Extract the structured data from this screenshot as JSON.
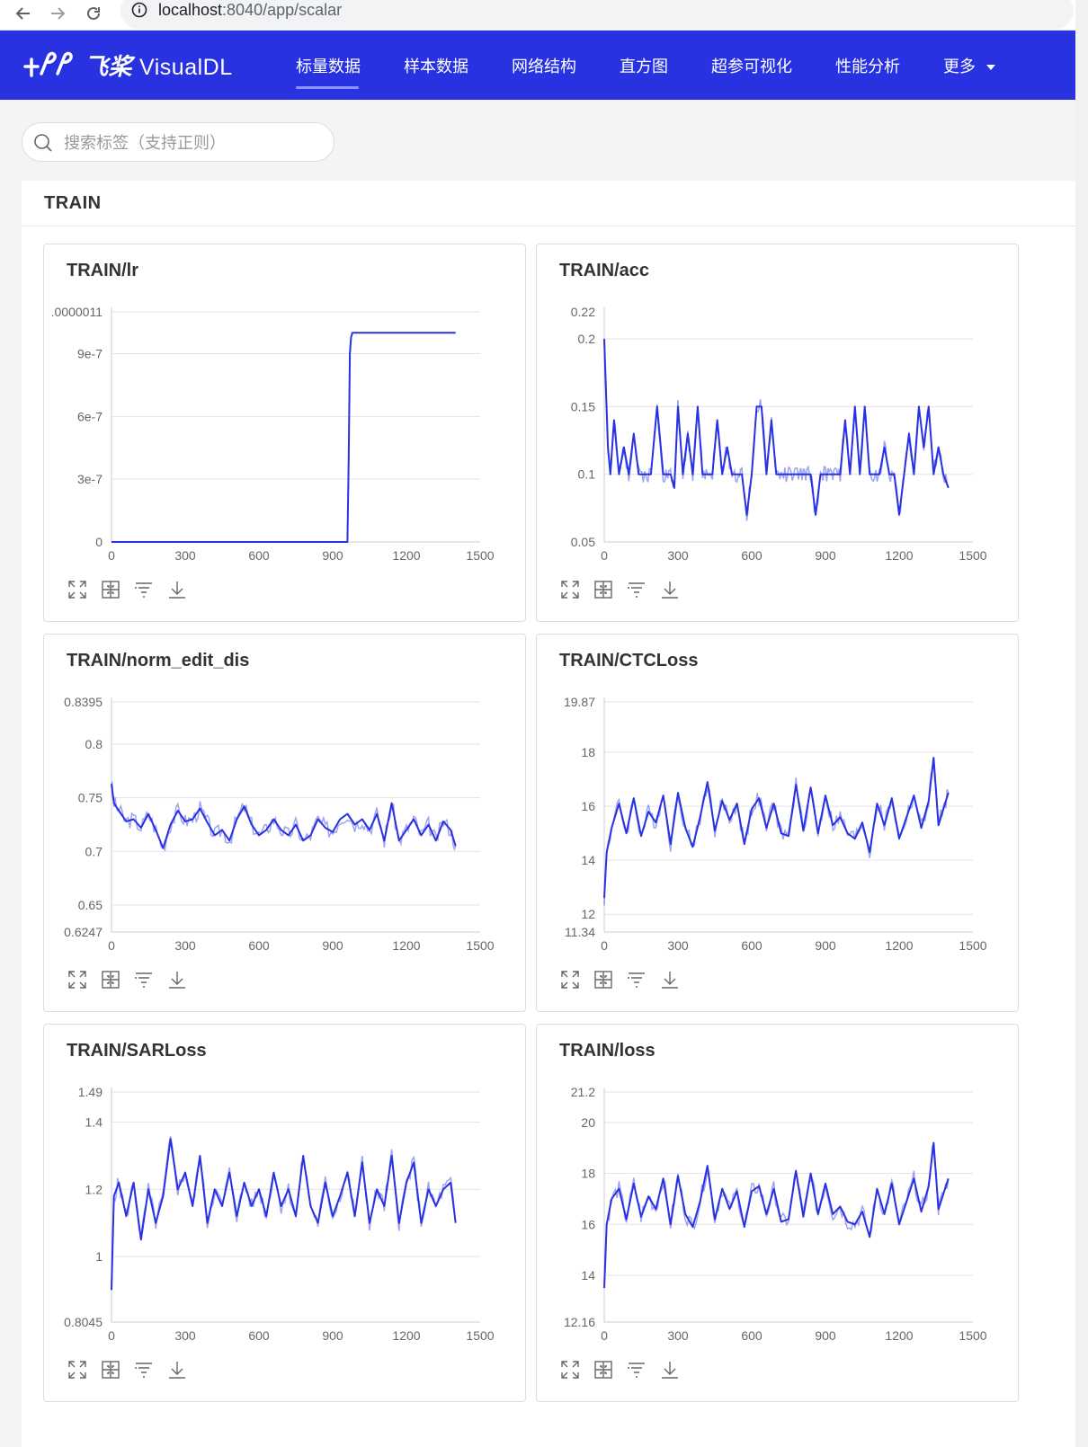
{
  "browser": {
    "url_host": "localhost",
    "url_rest": ":8040/app/scalar"
  },
  "app": {
    "logo_cn": "飞桨",
    "logo_en": "VisualDL",
    "nav": [
      {
        "label": "标量数据",
        "active": true
      },
      {
        "label": "样本数据",
        "active": false
      },
      {
        "label": "网络结构",
        "active": false
      },
      {
        "label": "直方图",
        "active": false
      },
      {
        "label": "超参可视化",
        "active": false
      },
      {
        "label": "性能分析",
        "active": false
      },
      {
        "label": "更多",
        "active": false
      }
    ],
    "colors": {
      "header_bg": "#2932e1",
      "series": "#2932e1"
    }
  },
  "search": {
    "placeholder": "搜索标签（支持正则）",
    "value": ""
  },
  "group": {
    "title": "TRAIN"
  },
  "toolbar_icons": [
    "fullscreen-icon",
    "restore-zoom-icon",
    "filter-lines-icon",
    "download-icon"
  ],
  "chart_data": [
    {
      "type": "line",
      "title": "TRAIN/lr",
      "xlim": [
        0,
        1500
      ],
      "x_ticks": [
        "0",
        "300",
        "600",
        "900",
        "1200",
        "1500"
      ],
      "ylim": [
        0,
        1.1e-06
      ],
      "y_ticks": [
        {
          "v": 1.1e-06,
          "t": ".0000011"
        },
        {
          "v": 9e-07,
          "t": "9e-7"
        },
        {
          "v": 6e-07,
          "t": "6e-7"
        },
        {
          "v": 3e-07,
          "t": "3e-7"
        },
        {
          "v": 0,
          "t": "0"
        }
      ],
      "grid_y": [
        1.1e-06,
        9e-07,
        6e-07,
        3e-07,
        0
      ],
      "x": [
        0,
        960,
        965,
        970,
        975,
        980,
        1400
      ],
      "y": [
        0,
        0,
        4e-07,
        9e-07,
        9.8e-07,
        1e-06,
        1e-06
      ],
      "smoothed": null,
      "seed": 1
    },
    {
      "type": "line",
      "title": "TRAIN/acc",
      "xlim": [
        0,
        1500
      ],
      "x_ticks": [
        "0",
        "300",
        "600",
        "900",
        "1200",
        "1500"
      ],
      "ylim": [
        0.05,
        0.22
      ],
      "y_ticks": [
        {
          "v": 0.22,
          "t": "0.22"
        },
        {
          "v": 0.2,
          "t": "0.2"
        },
        {
          "v": 0.15,
          "t": "0.15"
        },
        {
          "v": 0.1,
          "t": "0.1"
        },
        {
          "v": 0.05,
          "t": "0.05"
        }
      ],
      "grid_y": [
        0.2,
        0.15,
        0.1,
        0.05
      ],
      "x": [
        0,
        15,
        25,
        40,
        60,
        80,
        100,
        120,
        140,
        165,
        190,
        215,
        240,
        255,
        270,
        285,
        300,
        320,
        340,
        360,
        380,
        400,
        420,
        440,
        460,
        480,
        500,
        520,
        540,
        560,
        580,
        600,
        620,
        640,
        660,
        680,
        700,
        720,
        740,
        760,
        780,
        800,
        820,
        840,
        860,
        880,
        900,
        920,
        940,
        960,
        980,
        1000,
        1020,
        1040,
        1060,
        1080,
        1100,
        1120,
        1140,
        1160,
        1180,
        1200,
        1220,
        1240,
        1260,
        1280,
        1300,
        1320,
        1340,
        1360,
        1380,
        1400
      ],
      "y": [
        0.2,
        0.12,
        0.1,
        0.14,
        0.1,
        0.12,
        0.1,
        0.13,
        0.1,
        0.1,
        0.1,
        0.15,
        0.1,
        0.1,
        0.1,
        0.09,
        0.15,
        0.1,
        0.13,
        0.1,
        0.15,
        0.1,
        0.1,
        0.1,
        0.14,
        0.1,
        0.12,
        0.1,
        0.1,
        0.1,
        0.07,
        0.1,
        0.15,
        0.15,
        0.1,
        0.14,
        0.1,
        0.1,
        0.1,
        0.1,
        0.1,
        0.1,
        0.1,
        0.1,
        0.07,
        0.1,
        0.1,
        0.1,
        0.1,
        0.1,
        0.14,
        0.1,
        0.15,
        0.1,
        0.15,
        0.1,
        0.1,
        0.1,
        0.12,
        0.1,
        0.1,
        0.07,
        0.1,
        0.13,
        0.1,
        0.15,
        0.12,
        0.15,
        0.1,
        0.12,
        0.1,
        0.09
      ],
      "smoothed": null,
      "seed": 2
    },
    {
      "type": "line",
      "title": "TRAIN/norm_edit_dis",
      "xlim": [
        0,
        1500
      ],
      "x_ticks": [
        "0",
        "300",
        "600",
        "900",
        "1200",
        "1500"
      ],
      "ylim": [
        0.6247,
        0.8395
      ],
      "y_ticks": [
        {
          "v": 0.8395,
          "t": "0.8395"
        },
        {
          "v": 0.8,
          "t": "0.8"
        },
        {
          "v": 0.75,
          "t": "0.75"
        },
        {
          "v": 0.7,
          "t": "0.7"
        },
        {
          "v": 0.65,
          "t": "0.65"
        },
        {
          "v": 0.6247,
          "t": "0.6247"
        }
      ],
      "grid_y": [
        0.8395,
        0.8,
        0.75,
        0.7,
        0.65,
        0.6247
      ],
      "x": [
        0,
        10,
        30,
        60,
        90,
        120,
        150,
        180,
        210,
        240,
        270,
        300,
        330,
        360,
        390,
        420,
        450,
        480,
        510,
        540,
        570,
        600,
        630,
        660,
        690,
        720,
        750,
        780,
        810,
        840,
        870,
        900,
        930,
        960,
        990,
        1020,
        1050,
        1080,
        1110,
        1140,
        1170,
        1200,
        1230,
        1260,
        1290,
        1320,
        1350,
        1380,
        1400
      ],
      "y": [
        0.763,
        0.745,
        0.738,
        0.728,
        0.73,
        0.722,
        0.735,
        0.72,
        0.703,
        0.725,
        0.738,
        0.728,
        0.73,
        0.74,
        0.727,
        0.715,
        0.72,
        0.71,
        0.73,
        0.742,
        0.725,
        0.715,
        0.72,
        0.73,
        0.72,
        0.715,
        0.725,
        0.71,
        0.715,
        0.73,
        0.722,
        0.718,
        0.73,
        0.735,
        0.725,
        0.73,
        0.72,
        0.735,
        0.71,
        0.745,
        0.71,
        0.72,
        0.73,
        0.715,
        0.725,
        0.71,
        0.728,
        0.72,
        0.705
      ],
      "smoothed": null,
      "seed": 3
    },
    {
      "type": "line",
      "title": "TRAIN/CTCLoss",
      "xlim": [
        0,
        1500
      ],
      "x_ticks": [
        "0",
        "300",
        "600",
        "900",
        "1200",
        "1500"
      ],
      "ylim": [
        11.34,
        19.87
      ],
      "y_ticks": [
        {
          "v": 19.87,
          "t": "19.87"
        },
        {
          "v": 18,
          "t": "18"
        },
        {
          "v": 16,
          "t": "16"
        },
        {
          "v": 14,
          "t": "14"
        },
        {
          "v": 12,
          "t": "12"
        },
        {
          "v": 11.34,
          "t": "11.34"
        }
      ],
      "grid_y": [
        19.87,
        18,
        16,
        14,
        12,
        11.34
      ],
      "x": [
        0,
        10,
        30,
        60,
        90,
        120,
        150,
        180,
        210,
        240,
        270,
        300,
        330,
        360,
        390,
        420,
        450,
        480,
        510,
        540,
        570,
        600,
        630,
        660,
        690,
        720,
        750,
        780,
        810,
        840,
        870,
        900,
        930,
        960,
        990,
        1020,
        1050,
        1080,
        1110,
        1140,
        1170,
        1200,
        1230,
        1260,
        1290,
        1320,
        1340,
        1360,
        1380,
        1400
      ],
      "y": [
        12.6,
        14.3,
        15.2,
        16.1,
        15.0,
        16.3,
        14.9,
        15.8,
        15.4,
        16.4,
        14.6,
        16.5,
        15.2,
        14.5,
        15.6,
        16.9,
        15.1,
        16.2,
        15.5,
        16.1,
        14.6,
        15.9,
        16.3,
        15.2,
        16.1,
        15.0,
        14.9,
        16.8,
        15.1,
        16.7,
        15.0,
        16.4,
        15.3,
        15.6,
        15.0,
        14.8,
        15.4,
        14.3,
        16.1,
        15.3,
        16.3,
        14.8,
        15.6,
        16.4,
        15.2,
        16.2,
        17.8,
        15.3,
        15.9,
        16.5
      ],
      "smoothed": null,
      "seed": 4
    },
    {
      "type": "line",
      "title": "TRAIN/SARLoss",
      "xlim": [
        0,
        1500
      ],
      "x_ticks": [
        "0",
        "300",
        "600",
        "900",
        "1200",
        "1500"
      ],
      "ylim": [
        0.8045,
        1.49
      ],
      "y_ticks": [
        {
          "v": 1.49,
          "t": "1.49"
        },
        {
          "v": 1.4,
          "t": "1.4"
        },
        {
          "v": 1.2,
          "t": "1.2"
        },
        {
          "v": 1,
          "t": "1"
        },
        {
          "v": 0.8045,
          "t": "0.8045"
        }
      ],
      "grid_y": [
        1.49,
        1.4,
        1.2,
        1,
        0.8045
      ],
      "x": [
        0,
        10,
        30,
        60,
        90,
        120,
        150,
        180,
        210,
        240,
        270,
        300,
        330,
        360,
        390,
        420,
        450,
        480,
        510,
        540,
        570,
        600,
        630,
        660,
        690,
        720,
        750,
        780,
        810,
        840,
        870,
        900,
        930,
        960,
        990,
        1020,
        1050,
        1080,
        1110,
        1140,
        1170,
        1200,
        1230,
        1260,
        1290,
        1320,
        1350,
        1380,
        1400
      ],
      "y": [
        0.9,
        1.18,
        1.22,
        1.12,
        1.22,
        1.05,
        1.2,
        1.1,
        1.18,
        1.35,
        1.2,
        1.25,
        1.15,
        1.3,
        1.1,
        1.2,
        1.15,
        1.25,
        1.12,
        1.22,
        1.15,
        1.2,
        1.12,
        1.25,
        1.15,
        1.2,
        1.12,
        1.3,
        1.15,
        1.1,
        1.22,
        1.12,
        1.18,
        1.25,
        1.12,
        1.28,
        1.1,
        1.2,
        1.15,
        1.3,
        1.1,
        1.22,
        1.28,
        1.1,
        1.2,
        1.15,
        1.2,
        1.22,
        1.1
      ],
      "smoothed": null,
      "seed": 5
    },
    {
      "type": "line",
      "title": "TRAIN/loss",
      "xlim": [
        0,
        1500
      ],
      "x_ticks": [
        "0",
        "300",
        "600",
        "900",
        "1200",
        "1500"
      ],
      "ylim": [
        12.16,
        21.2
      ],
      "y_ticks": [
        {
          "v": 21.2,
          "t": "21.2"
        },
        {
          "v": 20,
          "t": "20"
        },
        {
          "v": 18,
          "t": "18"
        },
        {
          "v": 16,
          "t": "16"
        },
        {
          "v": 14,
          "t": "14"
        },
        {
          "v": 12.16,
          "t": "12.16"
        }
      ],
      "grid_y": [
        21.2,
        20,
        18,
        16,
        14,
        12.16
      ],
      "x": [
        0,
        10,
        30,
        60,
        90,
        120,
        150,
        180,
        210,
        240,
        270,
        300,
        330,
        360,
        390,
        420,
        450,
        480,
        510,
        540,
        570,
        600,
        630,
        660,
        690,
        720,
        750,
        780,
        810,
        840,
        870,
        900,
        930,
        960,
        990,
        1020,
        1050,
        1080,
        1110,
        1140,
        1170,
        1200,
        1230,
        1260,
        1290,
        1320,
        1340,
        1360,
        1380,
        1400
      ],
      "y": [
        13.5,
        16.0,
        17.0,
        17.4,
        16.2,
        17.6,
        16.3,
        17.1,
        16.6,
        17.8,
        16.0,
        17.9,
        16.4,
        15.9,
        16.9,
        18.3,
        16.2,
        17.4,
        16.6,
        17.3,
        15.9,
        17.3,
        17.5,
        16.4,
        17.4,
        16.1,
        16.2,
        18.1,
        16.3,
        18.0,
        16.4,
        17.6,
        16.4,
        16.7,
        16.1,
        16.0,
        16.5,
        15.5,
        17.4,
        16.4,
        17.6,
        16.0,
        16.9,
        17.8,
        16.5,
        17.5,
        19.2,
        16.6,
        17.2,
        17.8
      ],
      "smoothed": null,
      "seed": 6
    }
  ]
}
